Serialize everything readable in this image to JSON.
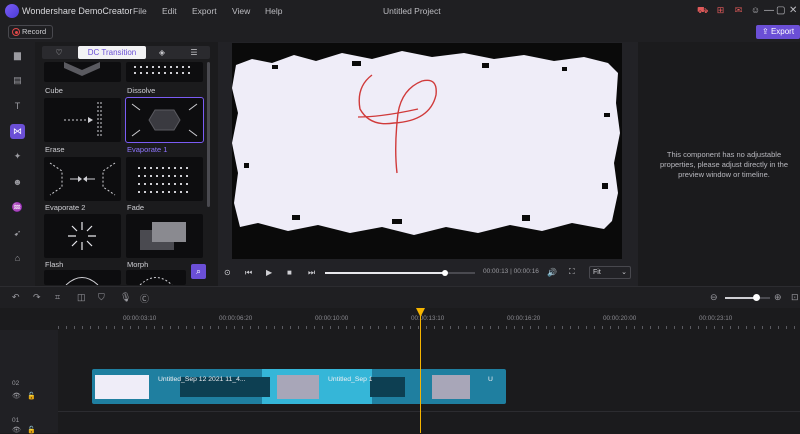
{
  "app": {
    "name": "Wondershare DemoCreator",
    "title": "Untitled Project"
  },
  "menu": [
    "File",
    "Edit",
    "Export",
    "View",
    "Help"
  ],
  "toolbar": {
    "record_label": "Record",
    "export_label": "Export"
  },
  "panel": {
    "tabs": [
      "♡",
      "DC Transition",
      "◈",
      "☰"
    ],
    "active_tab": "DC Transition",
    "items": [
      {
        "label": "Cube"
      },
      {
        "label": "Dissolve"
      },
      {
        "label": "Erase"
      },
      {
        "label": "Evaporate 1",
        "selected": true
      },
      {
        "label": "Evaporate 2"
      },
      {
        "label": "Fade"
      },
      {
        "label": "Flash"
      },
      {
        "label": "Morph"
      }
    ]
  },
  "preview": {
    "current_time": "00:00:13",
    "total_time": "00:00:16",
    "zoom_mode": "Fit",
    "progress": 0.8
  },
  "properties": {
    "message": "This component has no adjustable properties, please adjust directly in the preview window or timeline."
  },
  "timeline": {
    "ruler": [
      "00:00:03:10",
      "00:00:06:20",
      "00:00:10:00",
      "00:00:13:10",
      "00:00:16:20",
      "00:00:20:00",
      "00:00:23:10"
    ],
    "tracks": [
      {
        "num": "02"
      },
      {
        "num": "01"
      }
    ],
    "clips": [
      "Untitled_Sep 12 2021 11_4...",
      "Untitled_Sep 12 2021 11...",
      "U"
    ],
    "zoom": 0.7
  },
  "colors": {
    "accent": "#6b4fd6",
    "clip": "#1f7fa0",
    "clip_highlight": "#35b6d8",
    "playhead": "#f5b400"
  }
}
